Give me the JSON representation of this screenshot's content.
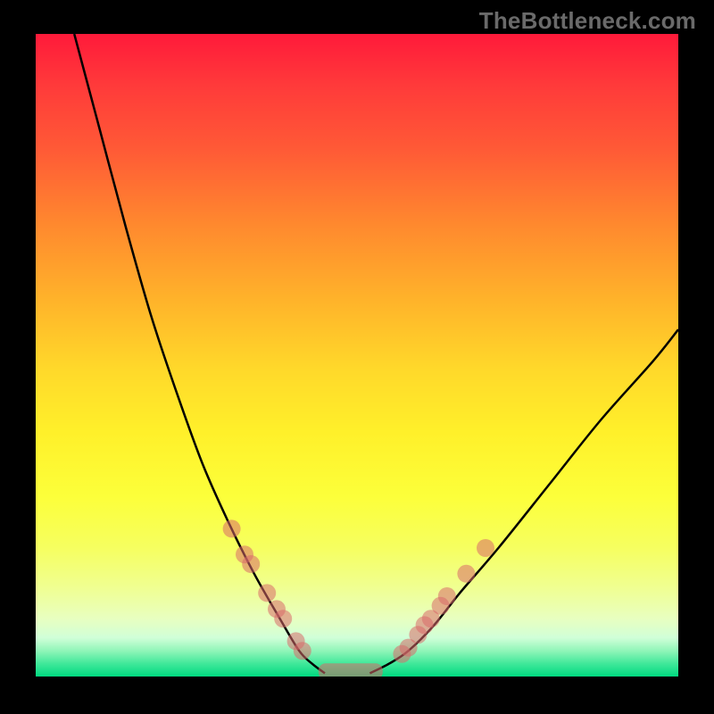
{
  "watermark": "TheBottleneck.com",
  "chart_data": {
    "type": "line",
    "title": "",
    "xlabel": "",
    "ylabel": "",
    "xlim": [
      0,
      100
    ],
    "ylim": [
      0,
      100
    ],
    "background_gradient": {
      "top": "#ff1a3a",
      "upper_mid": "#ffb52a",
      "mid": "#fff02a",
      "lower_mid": "#f0ff90",
      "bottom": "#00da80"
    },
    "series": [
      {
        "name": "left_curve",
        "x": [
          6,
          10,
          14,
          18,
          22,
          26,
          30,
          34,
          38,
          41,
          43,
          45
        ],
        "values": [
          100,
          85,
          70,
          56,
          44,
          33,
          24,
          16,
          9,
          4,
          2,
          0.5
        ]
      },
      {
        "name": "right_curve",
        "x": [
          52,
          55,
          58,
          62,
          66,
          72,
          80,
          88,
          96,
          100
        ],
        "values": [
          0.5,
          2,
          4,
          8,
          13,
          20,
          30,
          40,
          49,
          54
        ]
      }
    ],
    "dots_left": [
      {
        "x": 30.5,
        "y": 23
      },
      {
        "x": 32.5,
        "y": 19
      },
      {
        "x": 33.5,
        "y": 17.5
      },
      {
        "x": 36.0,
        "y": 13
      },
      {
        "x": 37.5,
        "y": 10.5
      },
      {
        "x": 38.5,
        "y": 9
      },
      {
        "x": 40.5,
        "y": 5.5
      },
      {
        "x": 41.5,
        "y": 4
      }
    ],
    "dots_right": [
      {
        "x": 57.0,
        "y": 3.5
      },
      {
        "x": 58.0,
        "y": 4.5
      },
      {
        "x": 59.5,
        "y": 6.5
      },
      {
        "x": 60.5,
        "y": 8
      },
      {
        "x": 61.5,
        "y": 9
      },
      {
        "x": 63.0,
        "y": 11
      },
      {
        "x": 64.0,
        "y": 12.5
      },
      {
        "x": 67.0,
        "y": 16
      },
      {
        "x": 70.0,
        "y": 20
      }
    ],
    "bottom_pill": {
      "x_start": 44,
      "x_end": 54,
      "y": 0.8
    }
  }
}
